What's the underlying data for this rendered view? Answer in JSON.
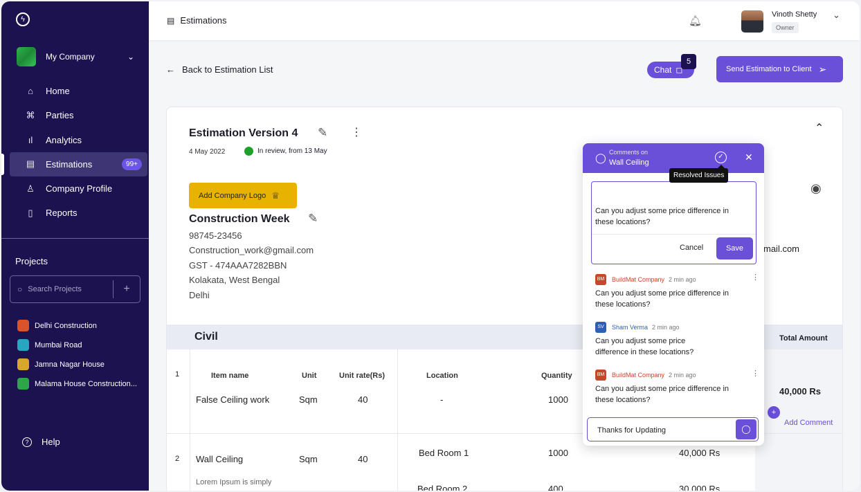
{
  "sidebar": {
    "company": "My Company",
    "nav": [
      {
        "label": "Home",
        "icon": "home-icon",
        "glyph": "⌂"
      },
      {
        "label": "Parties",
        "icon": "command-icon",
        "glyph": "⌘"
      },
      {
        "label": "Analytics",
        "icon": "analytics-icon",
        "glyph": "ıl"
      },
      {
        "label": "Estimations",
        "icon": "document-icon",
        "glyph": "▤",
        "badge": "99+"
      },
      {
        "label": "Company Profile",
        "icon": "user-icon",
        "glyph": "♙"
      },
      {
        "label": "Reports",
        "icon": "file-icon",
        "glyph": "▯"
      }
    ],
    "projects_title": "Projects",
    "search_placeholder": "Search Projects",
    "projects": [
      {
        "name": "Delhi Construction",
        "color": "#d9542b"
      },
      {
        "name": "Mumbai Road",
        "color": "#2aa5c0"
      },
      {
        "name": "Jamna Nagar House",
        "color": "#d8a62b"
      },
      {
        "name": "Malama House Construction...",
        "color": "#2fa44a"
      }
    ],
    "help": "Help"
  },
  "header": {
    "title": "Estimations",
    "user_name": "Vinoth Shetty",
    "user_role": "Owner"
  },
  "actions": {
    "back": "Back to Estimation List",
    "chat": "Chat",
    "chat_count": "5",
    "send": "Send Estimation to Client"
  },
  "estimation": {
    "title": "Estimation Version 4",
    "date": "4 May 2022",
    "status": "In review, from 13 May",
    "add_logo": "Add Company Logo",
    "company_name": "Construction Week",
    "phone": "98745-23456",
    "email": "Construction_work@gmail.com",
    "gst": "GST - 474AAA7282BBN",
    "address": "Kolakata, West Bengal",
    "city": "Delhi",
    "client_email_partial": "mail.com"
  },
  "table": {
    "section": "Civil",
    "headers": {
      "item": "Item name",
      "unit": "Unit",
      "rate": "Unit rate(Rs)",
      "location": "Location",
      "quantity": "Quantity",
      "total": "Total Amount"
    },
    "rows": [
      {
        "no": "1",
        "item": "False Ceiling work",
        "unit": "Sqm",
        "rate": "40",
        "location": "-",
        "quantity": "1000",
        "total": "40,000 Rs"
      },
      {
        "no": "2",
        "item": "Wall Ceiling",
        "unit": "Sqm",
        "rate": "40",
        "desc": "Lorem Ipsum is simply",
        "locations": [
          {
            "location": "Bed Room 1",
            "quantity": "1000",
            "amount": "40,000 Rs"
          },
          {
            "location": "Bed Room 2",
            "quantity": "400",
            "amount": "30,000 Rs"
          }
        ]
      }
    ],
    "add_comment": "Add Comment"
  },
  "comments": {
    "sub": "Comments on",
    "title": "Wall Ceiling",
    "tooltip": "Resolved Issues",
    "draft": "Can you adjust some price difference in these locations?",
    "cancel": "Cancel",
    "save": "Save",
    "items": [
      {
        "initials": "BM",
        "author": "BuildMat Company",
        "time": "2 min ago",
        "text": "Can you adjust some price difference in these locations?",
        "color": "#c8462b"
      },
      {
        "initials": "SV",
        "author": "Sham Verma",
        "time": "2 min ago",
        "text": "Can you adjust some price difference in these locations?",
        "color": "#2f5fb3"
      },
      {
        "initials": "BM",
        "author": "BuildMat Company",
        "time": "2 min ago",
        "text": "Can you adjust some price difference in these locations?",
        "color": "#c8462b"
      }
    ],
    "reply": "Thanks for Updating"
  }
}
